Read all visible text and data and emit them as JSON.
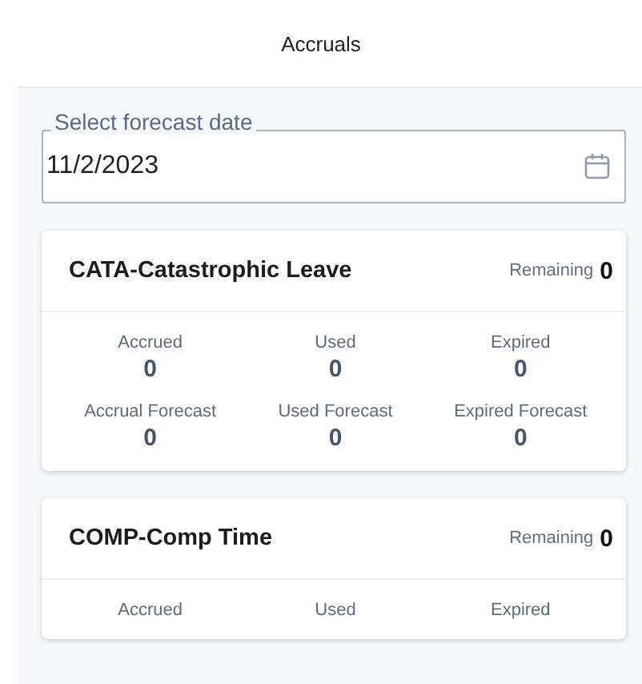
{
  "header": {
    "title": "Accruals"
  },
  "date_field": {
    "label": "Select forecast date",
    "value": "11/2/2023"
  },
  "cards": [
    {
      "title": "CATA-Catastrophic Leave",
      "remaining_label": "Remaining",
      "remaining_value": "0",
      "stats": [
        {
          "label": "Accrued",
          "value": "0"
        },
        {
          "label": "Used",
          "value": "0"
        },
        {
          "label": "Expired",
          "value": "0"
        },
        {
          "label": "Accrual Forecast",
          "value": "0"
        },
        {
          "label": "Used Forecast",
          "value": "0"
        },
        {
          "label": "Expired Forecast",
          "value": "0"
        }
      ]
    },
    {
      "title": "COMP-Comp Time",
      "remaining_label": "Remaining",
      "remaining_value": "0",
      "stats": [
        {
          "label": "Accrued"
        },
        {
          "label": "Used"
        },
        {
          "label": "Expired"
        }
      ]
    }
  ]
}
